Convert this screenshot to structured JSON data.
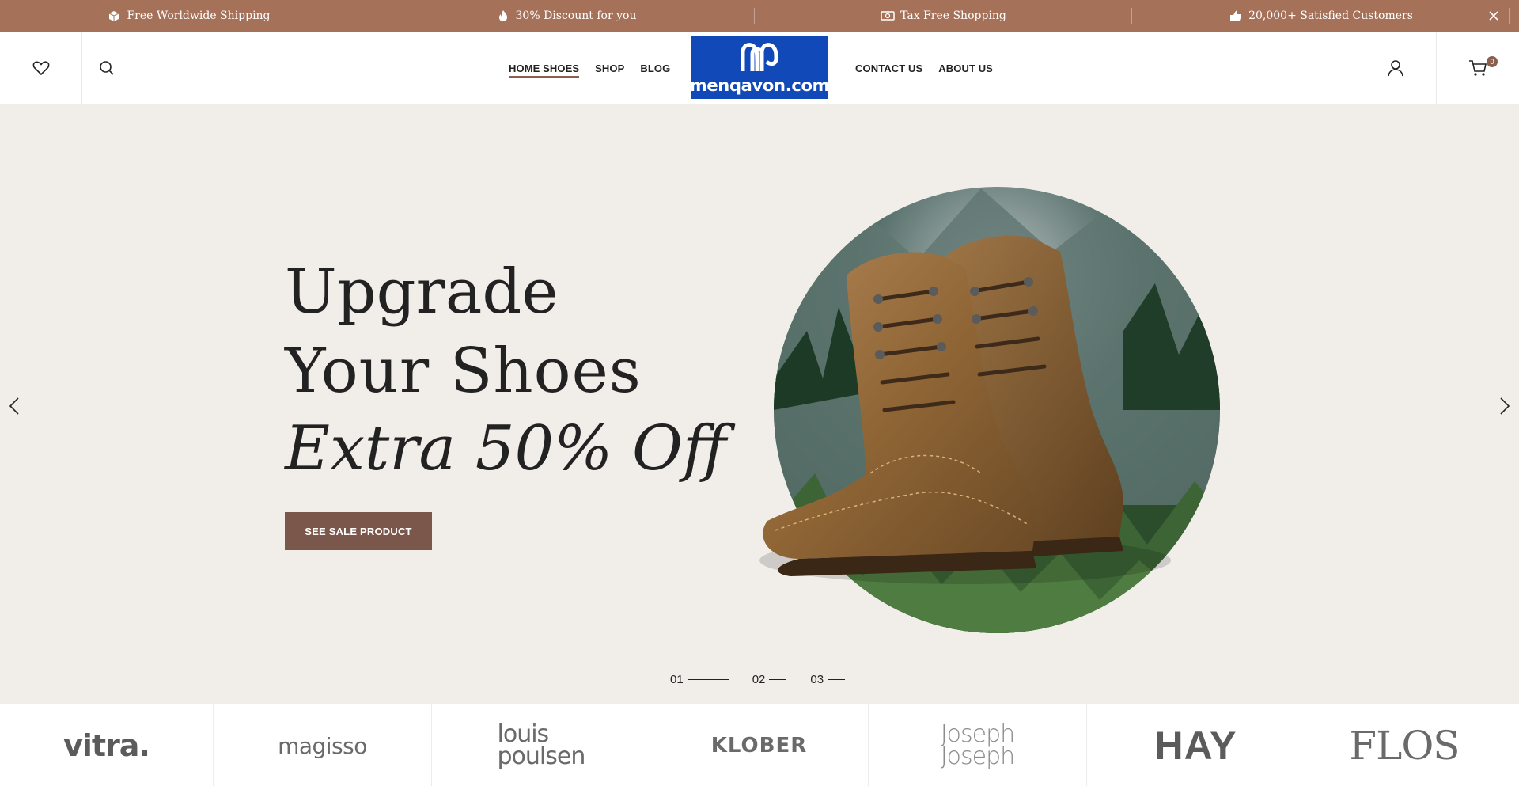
{
  "promo_bar": {
    "items": [
      {
        "icon": "box-icon",
        "text": "Free Worldwide Shipping"
      },
      {
        "icon": "flame-icon",
        "text": "30% Discount for you"
      },
      {
        "icon": "money-icon",
        "text": "Tax Free Shopping"
      },
      {
        "icon": "thumbs-up-icon",
        "text": "20,000+ Satisfied Customers"
      }
    ],
    "background": "#a57159"
  },
  "header": {
    "logo_text": "menqavon.com",
    "logo_color": "#1149b8",
    "nav_left": [
      "HOME SHOES",
      "SHOP",
      "BLOG"
    ],
    "nav_right": [
      "CONTACT US",
      "ABOUT US"
    ],
    "cart_count": "0"
  },
  "hero": {
    "line1": "Upgrade",
    "line2": "Your Shoes",
    "line3": "Extra 50% Off",
    "button_label": "SEE SALE PRODUCT",
    "button_color": "#7a574a",
    "slides": [
      "01",
      "02",
      "03"
    ],
    "active_slide": "01"
  },
  "brands": [
    "vitra.",
    "magisso",
    "louis poulsen",
    "KLOBER",
    "Joseph Joseph",
    "HAY",
    "FLOS"
  ]
}
